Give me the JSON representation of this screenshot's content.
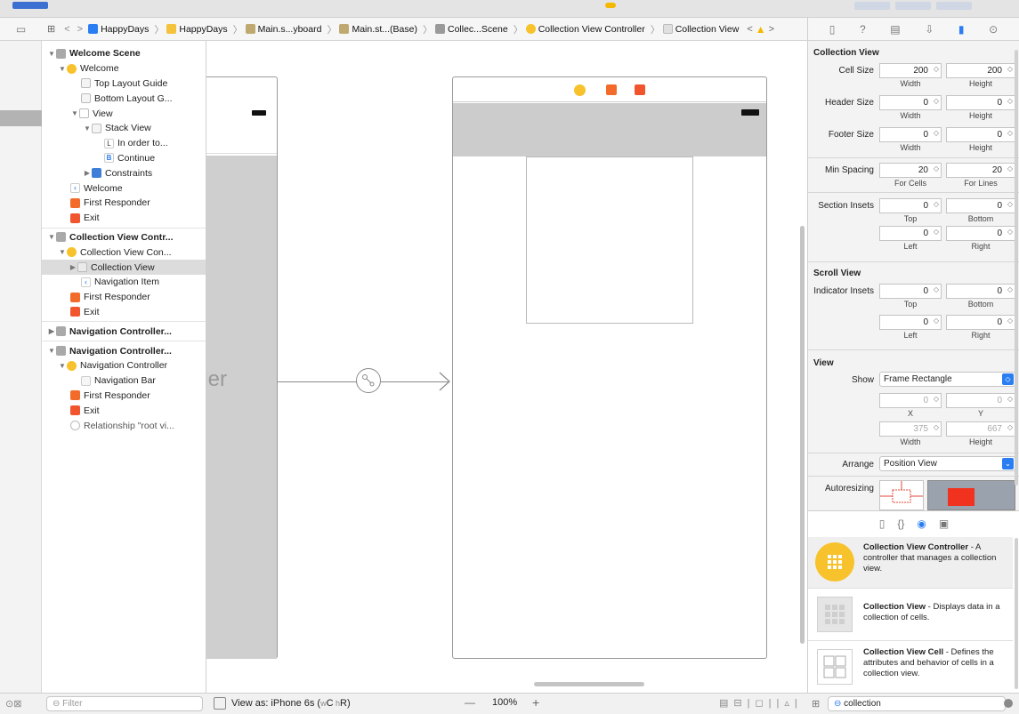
{
  "jump_bar": {
    "items": [
      "HappyDays",
      "HappyDays",
      "Main.s...yboard",
      "Main.st...(Base)",
      "Collec...Scene",
      "Collection View Controller",
      "Collection View"
    ]
  },
  "outline": {
    "rows": [
      {
        "label": "Welcome Scene"
      },
      {
        "label": "Welcome"
      },
      {
        "label": "Top Layout Guide"
      },
      {
        "label": "Bottom Layout G..."
      },
      {
        "label": "View"
      },
      {
        "label": "Stack View"
      },
      {
        "label": "In order to..."
      },
      {
        "label": "Continue"
      },
      {
        "label": "Constraints"
      },
      {
        "label": "Welcome"
      },
      {
        "label": "First Responder"
      },
      {
        "label": "Exit"
      },
      {
        "label": "Collection View Contr..."
      },
      {
        "label": "Collection View Con..."
      },
      {
        "label": "Collection View"
      },
      {
        "label": "Navigation Item"
      },
      {
        "label": "First Responder"
      },
      {
        "label": "Exit"
      },
      {
        "label": "Navigation Controller..."
      },
      {
        "label": "Navigation Controller..."
      },
      {
        "label": "Navigation Controller"
      },
      {
        "label": "Navigation Bar"
      },
      {
        "label": "First Responder"
      },
      {
        "label": "Exit"
      },
      {
        "label": "Relationship \"root vi..."
      }
    ],
    "icon_glyphs": {
      "label": "L",
      "button": "B"
    }
  },
  "canvas": {
    "partial_label": "ller"
  },
  "inspector": {
    "collection_view": {
      "title": "Collection View",
      "cell_size_label": "Cell Size",
      "cell_w": "200",
      "cell_h": "200",
      "header_size_label": "Header Size",
      "header_w": "0",
      "header_h": "0",
      "footer_size_label": "Footer Size",
      "footer_w": "0",
      "footer_h": "0",
      "min_spacing_label": "Min Spacing",
      "spacing_cells": "20",
      "spacing_lines": "20",
      "section_insets_label": "Section Insets",
      "inset_top": "0",
      "inset_bottom": "0",
      "inset_left": "0",
      "inset_right": "0",
      "width": "Width",
      "height": "Height",
      "for_cells": "For Cells",
      "for_lines": "For Lines",
      "top": "Top",
      "bottom": "Bottom",
      "left": "Left",
      "right": "Right"
    },
    "scroll_view": {
      "title": "Scroll View",
      "indicator_insets_label": "Indicator Insets",
      "top": "0",
      "bottom": "0",
      "left": "0",
      "right": "0"
    },
    "view": {
      "title": "View",
      "show_label": "Show",
      "show_value": "Frame Rectangle",
      "x": "0",
      "y": "0",
      "x_label": "X",
      "y_label": "Y",
      "w": "375",
      "h": "667",
      "arrange_label": "Arrange",
      "arrange_value": "Position View",
      "autoresizing_label": "Autoresizing"
    }
  },
  "library": {
    "items": [
      {
        "title": "Collection View Controller",
        "desc": " - A controller that manages a collection view."
      },
      {
        "title": "Collection View",
        "desc": " - Displays data in a collection of cells."
      },
      {
        "title": "Collection View Cell",
        "desc": " - Defines the attributes and behavior of cells in a collection view."
      }
    ],
    "search_value": "collection"
  },
  "bottom_bar": {
    "filter_placeholder": "Filter",
    "view_as": "View as: iPhone 6s (",
    "view_as_suffix": "C",
    "view_as_suffix2": "R)",
    "zoom": "100%",
    "minus": "—",
    "plus": "+"
  },
  "colors": {
    "accent": "#2a7ef2",
    "warning": "#f5b800",
    "vc_yellow": "#f7c22b",
    "responder_orange": "#f26b2b",
    "exit_red": "#f0552e"
  }
}
